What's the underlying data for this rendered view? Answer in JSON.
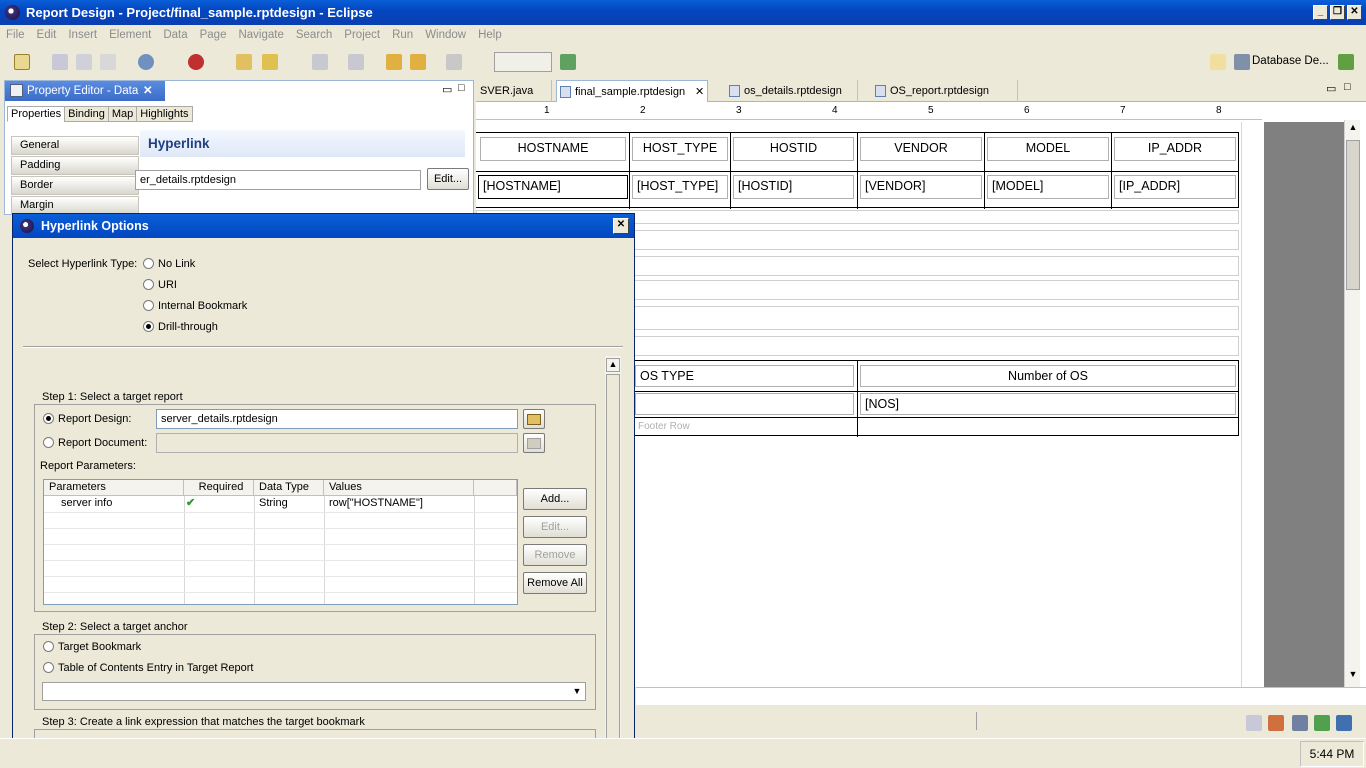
{
  "window": {
    "title": "Report Design - Project/final_sample.rptdesign - Eclipse"
  },
  "menu": [
    "File",
    "Edit",
    "Insert",
    "Element",
    "Data",
    "Page",
    "Navigate",
    "Search",
    "Project",
    "Run",
    "Window",
    "Help"
  ],
  "perspective": {
    "label": "Database De..."
  },
  "property_editor": {
    "title": "Property Editor - Data",
    "tabs": [
      "Properties",
      "Binding",
      "Map",
      "Highlights"
    ],
    "categories": [
      "General",
      "Padding",
      "Border",
      "Margin"
    ],
    "section": "Hyperlink",
    "link_value": "er_details.rptdesign",
    "edit_button": "Edit..."
  },
  "editor_tabs": [
    "SVER.java",
    "final_sample.rptdesign",
    "os_details.rptdesign",
    "OS_report.rptdesign"
  ],
  "ruler": [
    "1",
    "2",
    "3",
    "4",
    "5",
    "6",
    "7",
    "8"
  ],
  "report_table": {
    "headers": [
      "HOSTNAME",
      "HOST_TYPE",
      "HOSTID",
      "VENDOR",
      "MODEL",
      "IP_ADDR"
    ],
    "cells": [
      "[HOSTNAME]",
      "[HOST_TYPE]",
      "[HOSTID]",
      "[VENDOR]",
      "[MODEL]",
      "[IP_ADDR]"
    ]
  },
  "os_table": {
    "headers": [
      "OS TYPE",
      "Number of OS"
    ],
    "cells": [
      "",
      "[NOS]"
    ],
    "footer": "Footer Row"
  },
  "dialog": {
    "title": "Hyperlink Options",
    "type_label": "Select Hyperlink Type:",
    "types": [
      "No Link",
      "URI",
      "Internal Bookmark",
      "Drill-through"
    ],
    "selected_type": "Drill-through",
    "step1": {
      "label": "Step 1: Select a target report",
      "design_label": "Report Design:",
      "design_value": "server_details.rptdesign",
      "document_label": "Report Document:",
      "document_value": "",
      "params_label": "Report Parameters:"
    },
    "params_table": {
      "columns": [
        "Parameters",
        "Required",
        "Data Type",
        "Values"
      ],
      "rows": [
        {
          "name": "server info",
          "required": "✔",
          "type": "String",
          "value": "row[\"HOSTNAME\"]"
        }
      ]
    },
    "buttons": [
      "Add...",
      "Edit...",
      "Remove",
      "Remove All"
    ],
    "step2": {
      "label": "Step 2: Select a target anchor",
      "options": [
        "Target Bookmark",
        "Table of Contents Entry in Target Report"
      ]
    },
    "step3": {
      "label": "Step 3: Create a link expression that matches the target bookmark"
    }
  },
  "clock": "5:44 PM"
}
